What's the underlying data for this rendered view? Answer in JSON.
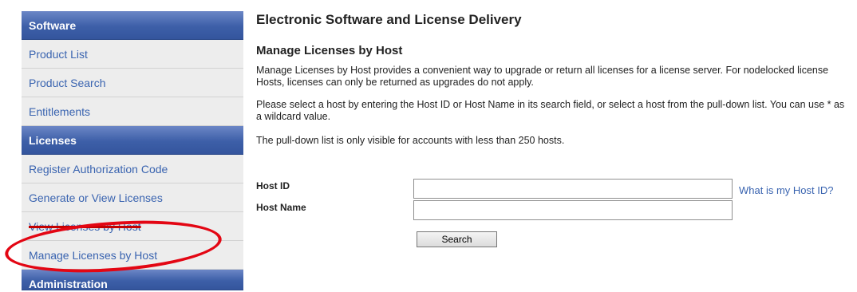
{
  "sidebar": {
    "sections": {
      "software": "Software",
      "licenses": "Licenses",
      "administration": "Administration"
    },
    "software_items": [
      "Product List",
      "Product Search",
      "Entitlements"
    ],
    "license_items": [
      "Register Authorization Code",
      "Generate or View Licenses",
      "View Licenses by Host",
      "Manage Licenses by Host"
    ]
  },
  "main": {
    "page_title": "Electronic Software and License Delivery",
    "section_title": "Manage Licenses by Host",
    "paragraph1": "Manage Licenses by Host provides a convenient way to upgrade or return all licenses for a license server. For nodelocked license Hosts, licenses can only be returned as upgrades do not apply.",
    "paragraph2": "Please select a host by entering the Host ID or Host Name in its search field, or select a host from the pull-down list. You can use * as a wildcard value.",
    "paragraph3": "The pull-down list is only visible for accounts with less than 250 hosts.",
    "form": {
      "host_id_label": "Host ID",
      "host_id_value": "",
      "host_name_label": "Host Name",
      "host_name_value": "",
      "help_link": "What is my Host ID?",
      "search_button": "Search"
    }
  },
  "colors": {
    "sidebar_header": "#3d5fa8",
    "link": "#3a64b0",
    "annotation": "#e30613"
  }
}
